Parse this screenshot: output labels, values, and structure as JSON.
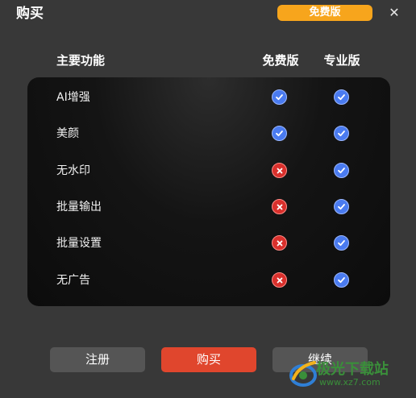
{
  "dialog": {
    "title": "购买",
    "badge": "免费版",
    "close_icon": "close-icon"
  },
  "header": {
    "feature": "主要功能",
    "free": "免费版",
    "pro": "专业版"
  },
  "features": [
    {
      "label": "AI增强",
      "free": "check",
      "pro": "check"
    },
    {
      "label": "美颜",
      "free": "check",
      "pro": "check"
    },
    {
      "label": "无水印",
      "free": "cross",
      "pro": "check"
    },
    {
      "label": "批量输出",
      "free": "cross",
      "pro": "check"
    },
    {
      "label": "批量设置",
      "free": "cross",
      "pro": "check"
    },
    {
      "label": "无广告",
      "free": "cross",
      "pro": "check"
    }
  ],
  "buttons": {
    "register": "注册",
    "buy": "购买",
    "continue": "继续"
  },
  "watermark": {
    "text": "极光下载站",
    "url": "www.xz7.com"
  },
  "colors": {
    "badge": "#f7a51c",
    "check": "#4a7bf0",
    "cross": "#d9302c",
    "buy_button": "#e0462d",
    "button_gray": "#555555"
  }
}
